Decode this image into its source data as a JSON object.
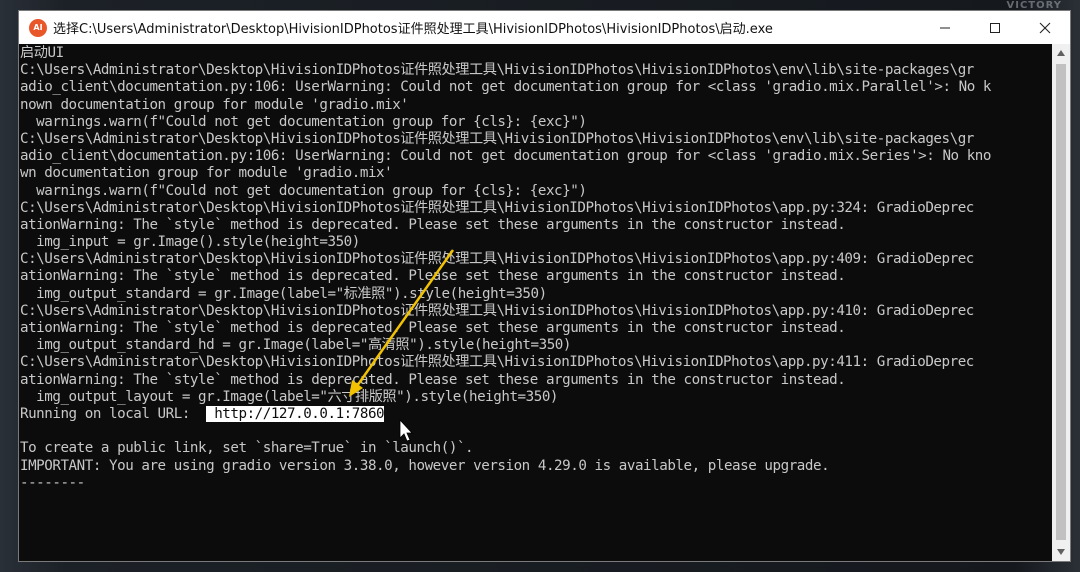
{
  "desktop": {
    "corner_label": "VICTORY"
  },
  "window": {
    "icon_text": "AI",
    "title": "选择C:\\Users\\Administrator\\Desktop\\HivisionIDPhotos证件照处理工具\\HivisionIDPhotos\\HivisionIDPhotos\\启动.exe",
    "controls": {
      "minimize": "minimize-icon",
      "maximize": "maximize-icon",
      "close": "close-icon"
    }
  },
  "console": {
    "lines": [
      "启动UI",
      "C:\\Users\\Administrator\\Desktop\\HivisionIDPhotos证件照处理工具\\HivisionIDPhotos\\HivisionIDPhotos\\env\\lib\\site-packages\\gr",
      "adio_client\\documentation.py:106: UserWarning: Could not get documentation group for <class 'gradio.mix.Parallel'>: No k",
      "nown documentation group for module 'gradio.mix'",
      "  warnings.warn(f\"Could not get documentation group for {cls}: {exc}\")",
      "C:\\Users\\Administrator\\Desktop\\HivisionIDPhotos证件照处理工具\\HivisionIDPhotos\\HivisionIDPhotos\\env\\lib\\site-packages\\gr",
      "adio_client\\documentation.py:106: UserWarning: Could not get documentation group for <class 'gradio.mix.Series'>: No kno",
      "wn documentation group for module 'gradio.mix'",
      "  warnings.warn(f\"Could not get documentation group for {cls}: {exc}\")",
      "C:\\Users\\Administrator\\Desktop\\HivisionIDPhotos证件照处理工具\\HivisionIDPhotos\\HivisionIDPhotos\\app.py:324: GradioDeprec",
      "ationWarning: The `style` method is deprecated. Please set these arguments in the constructor instead.",
      "  img_input = gr.Image().style(height=350)",
      "C:\\Users\\Administrator\\Desktop\\HivisionIDPhotos证件照处理工具\\HivisionIDPhotos\\HivisionIDPhotos\\app.py:409: GradioDeprec",
      "ationWarning: The `style` method is deprecated. Please set these arguments in the constructor instead.",
      "  img_output_standard = gr.Image(label=\"标准照\").style(height=350)",
      "C:\\Users\\Administrator\\Desktop\\HivisionIDPhotos证件照处理工具\\HivisionIDPhotos\\HivisionIDPhotos\\app.py:410: GradioDeprec",
      "ationWarning: The `style` method is deprecated. Please set these arguments in the constructor instead.",
      "  img_output_standard_hd = gr.Image(label=\"高清照\").style(height=350)",
      "C:\\Users\\Administrator\\Desktop\\HivisionIDPhotos证件照处理工具\\HivisionIDPhotos\\HivisionIDPhotos\\app.py:411: GradioDeprec",
      "ationWarning: The `style` method is deprecated. Please set these arguments in the constructor instead.",
      "  img_output_layout = gr.Image(label=\"六寸排版照\").style(height=350)"
    ],
    "running_label": "Running on local URL:  ",
    "url": " http://127.0.0.1:7860",
    "blank": "",
    "after_lines": [
      "To create a public link, set `share=True` in `launch()`.",
      "IMPORTANT: You are using gradio version 3.38.0, however version 4.29.0 is available, please upgrade.",
      "--------"
    ]
  },
  "colors": {
    "console_bg": "#0c0c0c",
    "console_text": "#c8c8c8",
    "arrow": "#f2c200"
  }
}
